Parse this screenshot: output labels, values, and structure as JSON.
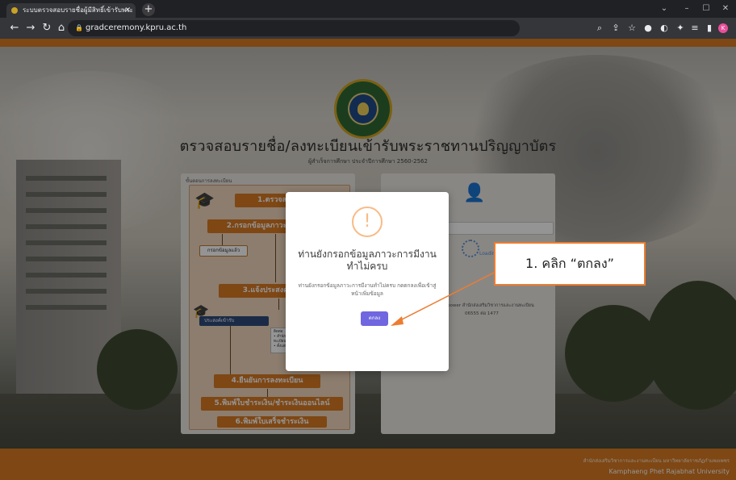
{
  "browser": {
    "tab_title": "ระบบตรวจสอบรายชื่อผู้มีสิทธิ์เข้ารับพระ",
    "url": "gradceremony.kpru.ac.th"
  },
  "page": {
    "title": "ตรวจสอบรายชื่อ/ลงทะเบียนเข้ารับพระราชทานปริญญาบัตร",
    "subtitle": "ผู้สำเร็จการศึกษา ประจำปีการศึกษา 2560-2562",
    "steps_heading": "ขั้นตอนการลงทะเบียน",
    "steps": [
      "1.ตรวจสอบรายชื่อ",
      "2.กรอกข้อมูลภาวะการมีงานทำ",
      "3.แจ้งประสงค์การเข้ารับ",
      "4.ยืนยันการลงทะเบียน",
      "5.พิมพ์ใบชำระเงิน/ชำระเงินออนไลน์",
      "6.พิมพ์ใบเสร็จชำระเงิน"
    ],
    "filled_label": "กรอกข้อมูลแล้ว",
    "intent_label": "ประสงค์เข้ารับ",
    "note_lines": [
      "ติดต่อ",
      "• สำนักส่งเสริมวิชาการและงาน",
      "ทะเบียน อาคาร 14 ชั้น 2",
      "• ตั้งแต่ วันที่ 1 - 30 มิ.ย. 2566 เป็นต้นไป"
    ],
    "loading_label": "Loading...",
    "contact_line1": "power สำนักส่งเสริมวิชาการและงานทะเบียน",
    "contact_line2": "06555 ต่อ 1477",
    "footer_thai": "สำนักส่งเสริมวิชาการและงานทะเบียน มหาวิทยาลัยราชภัฏกำแพงเพชร",
    "footer_en": "Kamphaeng Phet Rajabhat University"
  },
  "modal": {
    "icon": "!",
    "title": "ท่านยังกรอกข้อมูลภาวะการมีงานทำไม่ครบ",
    "text": "ท่านยังกรอกข้อมูลภาวะการมีงานทำไม่ครบ กดตกลงเพื่อเข้าสู่หน้าเพิ่มข้อมูล",
    "ok_label": "ตกลง"
  },
  "annotation": {
    "text": "1. คลิก “ตกลง”",
    "color": "#ed7d31"
  },
  "colors": {
    "accent": "#d97a23",
    "ok_button": "#7066e0",
    "warning": "#f8bb86"
  }
}
